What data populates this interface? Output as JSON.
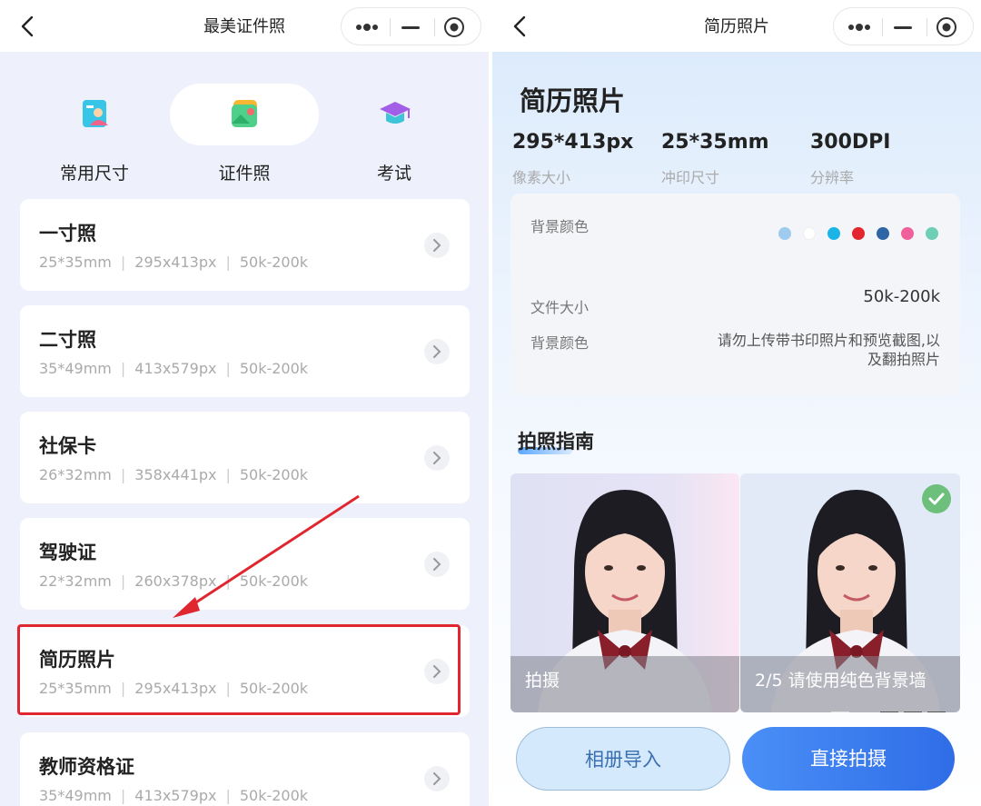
{
  "left": {
    "nav": {
      "title": "最美证件照"
    },
    "categories": [
      {
        "label": "常用尺寸",
        "icon": "id-card-icon"
      },
      {
        "label": "证件照",
        "icon": "photo-icon"
      },
      {
        "label": "考试",
        "icon": "graduation-cap-icon"
      }
    ],
    "active_category": "证件照",
    "items": [
      {
        "title": "一寸照",
        "size": "25*35mm",
        "px": "295x413px",
        "file": "50k-200k"
      },
      {
        "title": "二寸照",
        "size": "35*49mm",
        "px": "413x579px",
        "file": "50k-200k"
      },
      {
        "title": "社保卡",
        "size": "26*32mm",
        "px": "358x441px",
        "file": "50k-200k"
      },
      {
        "title": "驾驶证",
        "size": "22*32mm",
        "px": "260x378px",
        "file": "50k-200k"
      },
      {
        "title": "简历照片",
        "size": "25*35mm",
        "px": "295x413px",
        "file": "50k-200k"
      },
      {
        "title": "教师资格证",
        "size": "35*49mm",
        "px": "413x579px",
        "file": "50k-200k"
      }
    ],
    "highlighted_item": "简历照片"
  },
  "right": {
    "nav": {
      "title": "简历照片"
    },
    "heading": "简历照片",
    "specs": [
      {
        "value": "295*413px",
        "label": "像素大小"
      },
      {
        "value": "25*35mm",
        "label": "冲印尺寸"
      },
      {
        "value": "300DPI",
        "label": "分辨率"
      }
    ],
    "info": {
      "bg_color_label": "背景颜色",
      "bg_colors": [
        "#9fcbee",
        "#ffffff",
        "#1ab4e6",
        "#e3262e",
        "#2e66a5",
        "#f0609a",
        "#6dcfb6"
      ],
      "file_size_label": "文件大小",
      "file_size_value": "50k-200k",
      "note_label": "背景颜色",
      "note_value": "请勿上传带书印照片和预览截图,以及翻拍照片"
    },
    "guide_title": "拍照指南",
    "photos": [
      {
        "caption": "拍摄",
        "checked": false
      },
      {
        "caption": "2/5 请使用纯色背景墙",
        "checked": true
      }
    ],
    "pager": {
      "current": 1,
      "total": 4
    },
    "buttons": {
      "album": "相册导入",
      "shoot": "直接拍摄"
    }
  },
  "colors": {
    "accent": "#2f6de8",
    "highlight": "#e0262e",
    "check": "#6cc07b"
  }
}
